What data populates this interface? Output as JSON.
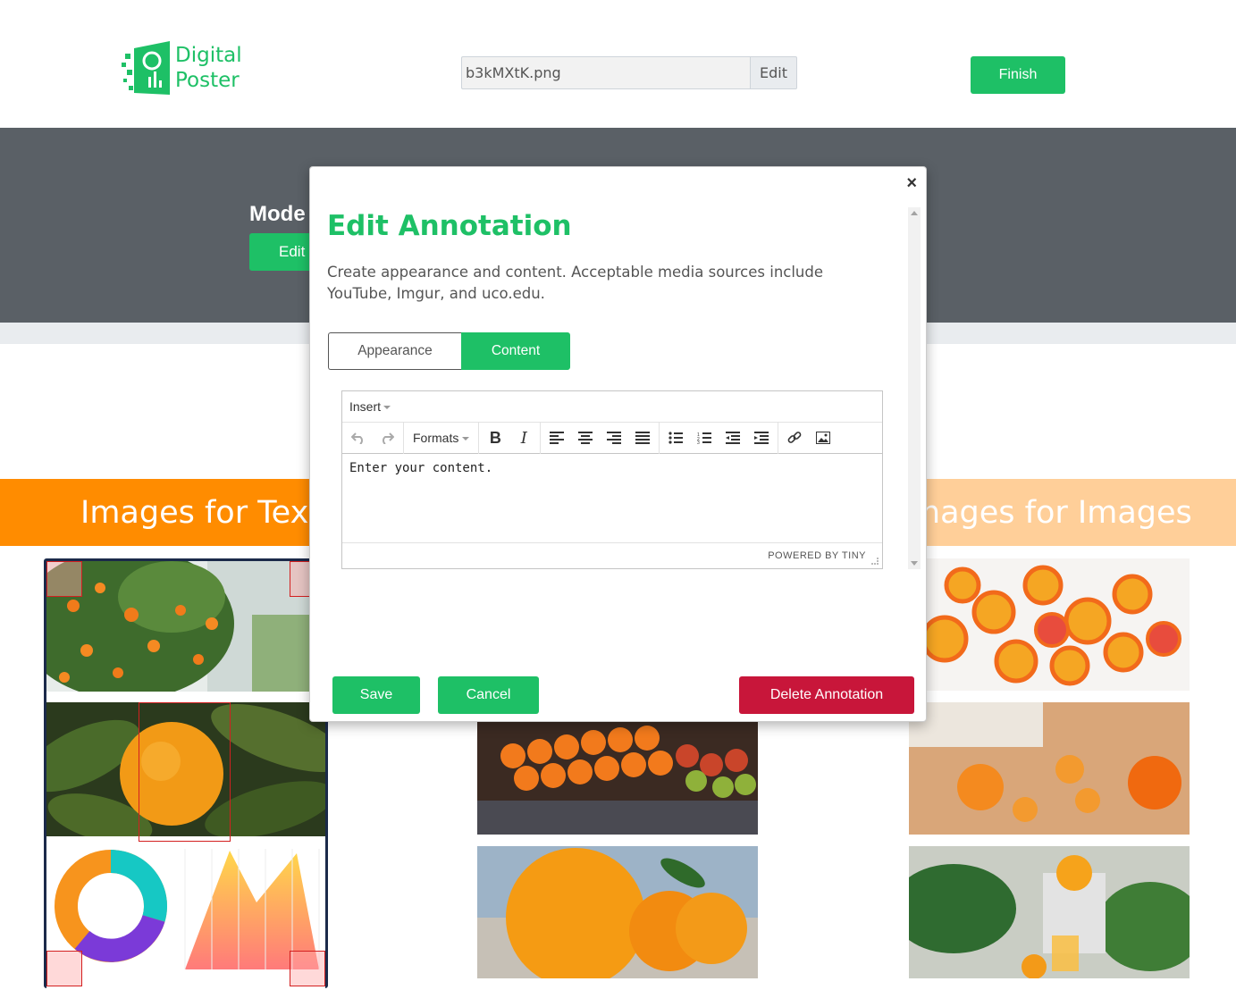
{
  "header": {
    "logo_line1": "Digital",
    "logo_line2": "Poster",
    "file_name": "b3kMXtK.png",
    "file_edit_label": "Edit",
    "finish_label": "Finish"
  },
  "band": {
    "mode_title": "Mode",
    "edit_label": "Edit"
  },
  "sections": {
    "left_title": "Images for Text",
    "right_title": "mages for Images"
  },
  "modal": {
    "title": "Edit Annotation",
    "description": "Create appearance and content. Acceptable media sources include YouTube, Imgur, and uco.edu.",
    "close_icon": "×",
    "tabs": {
      "appearance": "Appearance",
      "content": "Content",
      "active": "content"
    },
    "editor": {
      "menu_insert": "Insert",
      "formats_label": "Formats",
      "bold_label": "B",
      "italic_label": "I",
      "content_text": "Enter your content.",
      "powered_by": "POWERED BY TINY"
    },
    "buttons": {
      "save": "Save",
      "cancel": "Cancel",
      "delete": "Delete Annotation"
    }
  },
  "colors": {
    "brand_green": "#1ec066",
    "band_grey": "#5a6066",
    "orange": "#ff8c00",
    "light_orange": "#ffcf99",
    "delete_red": "#c8163a"
  }
}
